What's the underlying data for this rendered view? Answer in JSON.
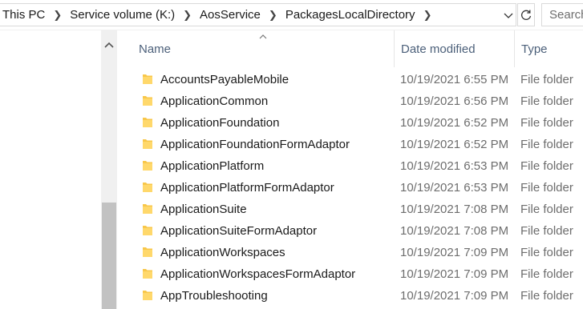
{
  "address_bar": {
    "crumbs": [
      "This PC",
      "Service volume (K:)",
      "AosService",
      "PackagesLocalDirectory"
    ]
  },
  "search": {
    "placeholder": "Search"
  },
  "columns": {
    "name": "Name",
    "date": "Date modified",
    "type": "Type"
  },
  "files": [
    {
      "name": "AccountsPayableMobile",
      "date": "10/19/2021 6:55 PM",
      "type": "File folder"
    },
    {
      "name": "ApplicationCommon",
      "date": "10/19/2021 6:56 PM",
      "type": "File folder"
    },
    {
      "name": "ApplicationFoundation",
      "date": "10/19/2021 6:52 PM",
      "type": "File folder"
    },
    {
      "name": "ApplicationFoundationFormAdaptor",
      "date": "10/19/2021 6:52 PM",
      "type": "File folder"
    },
    {
      "name": "ApplicationPlatform",
      "date": "10/19/2021 6:53 PM",
      "type": "File folder"
    },
    {
      "name": "ApplicationPlatformFormAdaptor",
      "date": "10/19/2021 6:53 PM",
      "type": "File folder"
    },
    {
      "name": "ApplicationSuite",
      "date": "10/19/2021 7:08 PM",
      "type": "File folder"
    },
    {
      "name": "ApplicationSuiteFormAdaptor",
      "date": "10/19/2021 7:08 PM",
      "type": "File folder"
    },
    {
      "name": "ApplicationWorkspaces",
      "date": "10/19/2021 7:09 PM",
      "type": "File folder"
    },
    {
      "name": "ApplicationWorkspacesFormAdaptor",
      "date": "10/19/2021 7:09 PM",
      "type": "File folder"
    },
    {
      "name": "AppTroubleshooting",
      "date": "10/19/2021 7:09 PM",
      "type": "File folder"
    }
  ],
  "icons": {
    "folder": "folder-icon",
    "chevron": "chevron-right-icon",
    "dropdown": "chevron-down-icon",
    "refresh": "refresh-icon",
    "sort": "sort-ascending-icon",
    "scroll_up": "scroll-up-icon"
  },
  "colors": {
    "folder": "#f8c74a",
    "header_text": "#4c607a",
    "meta_text": "#6d6d6d"
  }
}
